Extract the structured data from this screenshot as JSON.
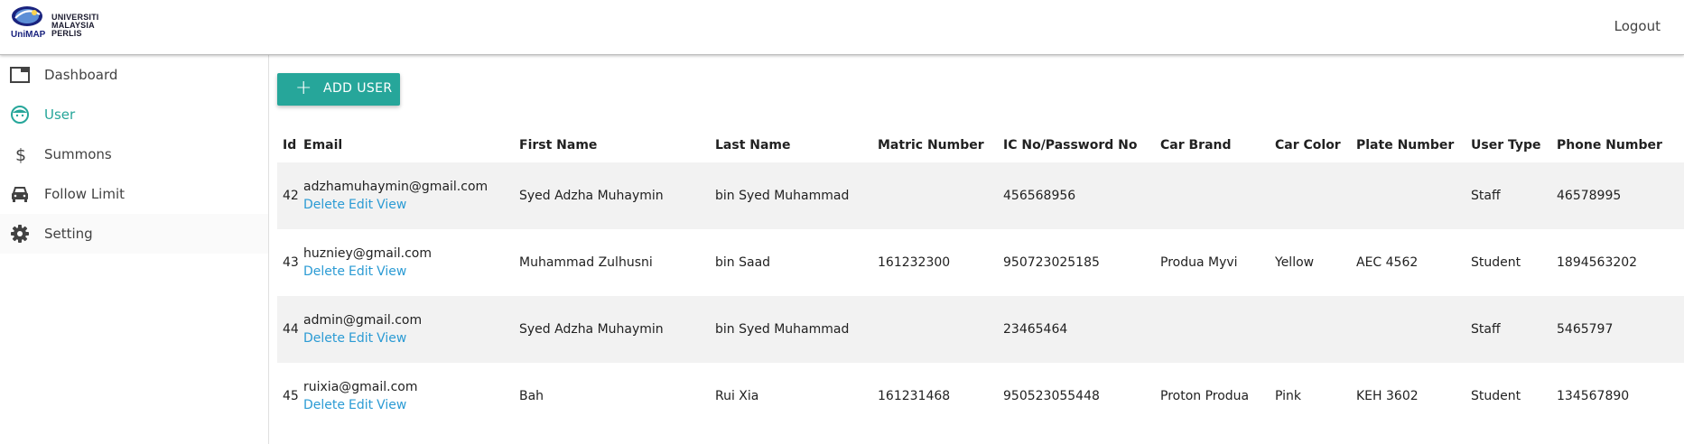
{
  "header": {
    "logo_lines": [
      "UNIVERSITI",
      "MALAYSIA",
      "PERLIS"
    ],
    "logo_tag": "UniMAP",
    "logout_label": "Logout"
  },
  "sidebar": {
    "items": [
      {
        "label": "Dashboard",
        "icon": "dashboard-icon"
      },
      {
        "label": "User",
        "icon": "face-icon"
      },
      {
        "label": "Summons",
        "icon": "dollar-icon"
      },
      {
        "label": "Follow Limit",
        "icon": "car-icon"
      },
      {
        "label": "Setting",
        "icon": "gear-icon"
      }
    ]
  },
  "colors": {
    "accent": "#26a69a",
    "link": "#2b9bd4"
  },
  "toolbar": {
    "add_user_label": "ADD USER",
    "add_icon": "+"
  },
  "table": {
    "headers": [
      "Id",
      "Email",
      "First Name",
      "Last Name",
      "Matric Number",
      "IC No/Password No",
      "Car Brand",
      "Car Color",
      "Plate Number",
      "User Type",
      "Phone Number"
    ],
    "actions": {
      "delete": "Delete",
      "edit": "Edit",
      "view": "View"
    },
    "rows": [
      {
        "id": "42",
        "email": "adzhamuhaymin@gmail.com",
        "first_name": "Syed Adzha Muhaymin",
        "last_name": "bin Syed Muhammad",
        "matric": "",
        "ic": "456568956",
        "car_brand": "",
        "car_color": "",
        "plate": "",
        "user_type": "Staff",
        "phone": "46578995"
      },
      {
        "id": "43",
        "email": "huzniey@gmail.com",
        "first_name": "Muhammad Zulhusni",
        "last_name": "bin Saad",
        "matric": "161232300",
        "ic": "950723025185",
        "car_brand": "Produa Myvi",
        "car_color": "Yellow",
        "plate": "AEC 4562",
        "user_type": "Student",
        "phone": "1894563202"
      },
      {
        "id": "44",
        "email": "admin@gmail.com",
        "first_name": "Syed Adzha Muhaymin",
        "last_name": "bin Syed Muhammad",
        "matric": "",
        "ic": "23465464",
        "car_brand": "",
        "car_color": "",
        "plate": "",
        "user_type": "Staff",
        "phone": "5465797"
      },
      {
        "id": "45",
        "email": "ruixia@gmail.com",
        "first_name": "Bah",
        "last_name": "Rui Xia",
        "matric": "161231468",
        "ic": "950523055448",
        "car_brand": "Proton Produa",
        "car_color": "Pink",
        "plate": "KEH 3602",
        "user_type": "Student",
        "phone": "134567890"
      }
    ]
  }
}
